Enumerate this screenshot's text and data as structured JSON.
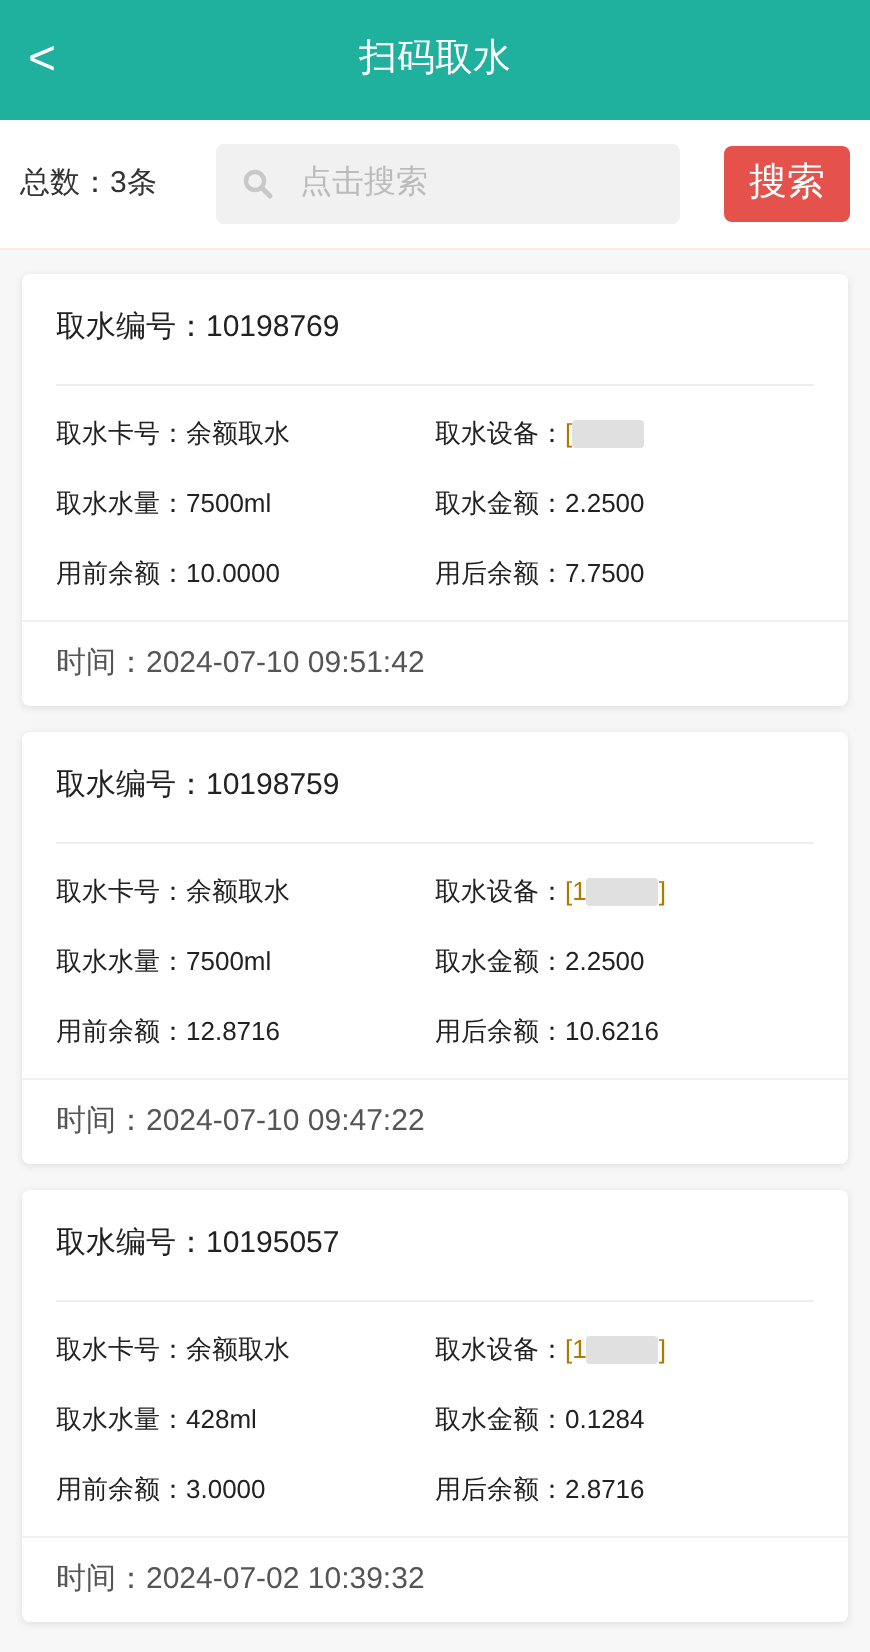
{
  "header": {
    "title": "扫码取水",
    "back": "<"
  },
  "toolbar": {
    "total": "总数：3条",
    "search_placeholder": "点击搜索",
    "search_button": "搜索"
  },
  "records": [
    {
      "title": "取水编号：10198769",
      "fields": [
        {
          "label": "取水卡号：",
          "value": "余额取水"
        },
        {
          "label": "取水设备：",
          "value": "[",
          "redacted": true
        },
        {
          "label": "取水水量：",
          "value": "7500ml"
        },
        {
          "label": "取水金额：",
          "value": "2.2500"
        },
        {
          "label": "用前余额：",
          "value": "10.0000"
        },
        {
          "label": "用后余额：",
          "value": "7.7500"
        }
      ],
      "time": "时间：2024-07-10 09:51:42"
    },
    {
      "title": "取水编号：10198759",
      "fields": [
        {
          "label": "取水卡号：",
          "value": "余额取水"
        },
        {
          "label": "取水设备：",
          "value": "[1",
          "suffix": "]",
          "redacted": true
        },
        {
          "label": "取水水量：",
          "value": "7500ml"
        },
        {
          "label": "取水金额：",
          "value": "2.2500"
        },
        {
          "label": "用前余额：",
          "value": "12.8716"
        },
        {
          "label": "用后余额：",
          "value": "10.6216"
        }
      ],
      "time": "时间：2024-07-10 09:47:22"
    },
    {
      "title": "取水编号：10195057",
      "fields": [
        {
          "label": "取水卡号：",
          "value": "余额取水"
        },
        {
          "label": "取水设备：",
          "value": "[1",
          "suffix": "]",
          "redacted": true
        },
        {
          "label": "取水水量：",
          "value": "428ml"
        },
        {
          "label": "取水金额：",
          "value": "0.1284"
        },
        {
          "label": "用前余额：",
          "value": "3.0000"
        },
        {
          "label": "用后余额：",
          "value": "2.8716"
        }
      ],
      "time": "时间：2024-07-02 10:39:32"
    }
  ]
}
